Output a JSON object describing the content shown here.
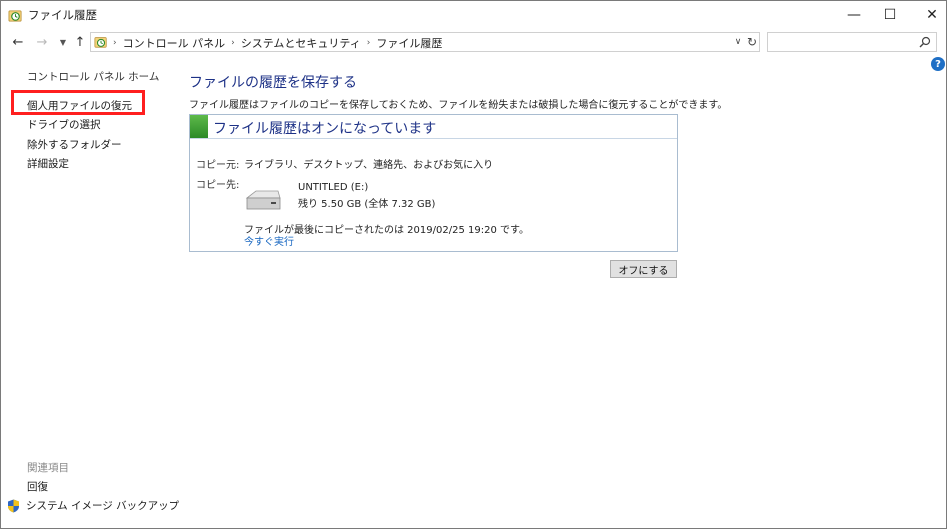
{
  "window": {
    "title": "ファイル履歴",
    "minimize_glyph": "—",
    "maximize_glyph": "☐",
    "close_glyph": "✕"
  },
  "nav": {
    "back_glyph": "←",
    "forward_glyph": "→",
    "recent_glyph": "▼",
    "up_glyph": "↑",
    "breadcrumbs": [
      "コントロール パネル",
      "システムとセキュリティ",
      "ファイル履歴"
    ],
    "crumb_separator": "›",
    "dropdown_glyph": "∨",
    "refresh_glyph": "↻",
    "search_placeholder": ""
  },
  "help_glyph": "?",
  "sidebar": {
    "home": "コントロール パネル ホーム",
    "items": [
      "個人用ファイルの復元",
      "ドライブの選択",
      "除外するフォルダー",
      "詳細設定"
    ],
    "related_heading": "関連項目",
    "related_items": [
      "回復",
      "システム イメージ バックアップ"
    ]
  },
  "main": {
    "title": "ファイルの履歴を保存する",
    "description": "ファイル履歴はファイルのコピーを保存しておくため、ファイルを紛失または破損した場合に復元することができます。",
    "status": "ファイル履歴はオンになっています",
    "source_label": "コピー元:",
    "source_value": "ライブラリ、デスクトップ、連絡先、およびお気に入り",
    "dest_label": "コピー先:",
    "drive_name": "UNTITLED (E:)",
    "drive_space": "残り 5.50 GB (全体 7.32 GB)",
    "last_copy": "ファイルが最後にコピーされたのは 2019/02/25 19:20 です。",
    "run_now": "今すぐ実行",
    "off_button": "オフにする"
  },
  "colors": {
    "title_blue": "#1e3287",
    "link_blue": "#1565c0",
    "status_green": "#3b9f33",
    "highlight_red": "#ff1f1f"
  }
}
